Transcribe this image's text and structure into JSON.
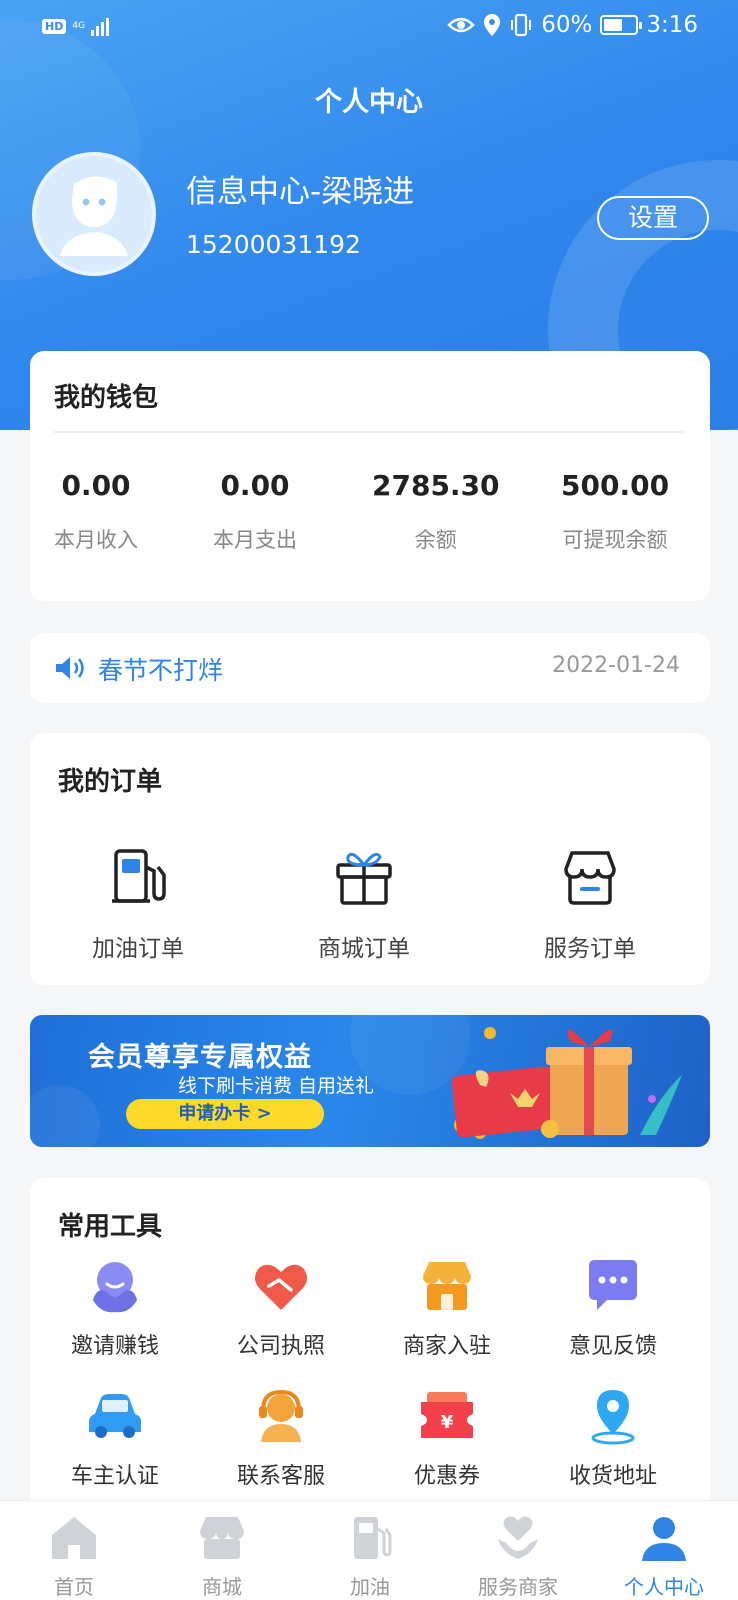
{
  "status_bar": {
    "network_badge": "HD",
    "network_type": "4G",
    "battery_percent": "60%",
    "battery_level": 0.6,
    "time": "3:16"
  },
  "page_title": "个人中心",
  "profile": {
    "name": "信息中心-梁晓进",
    "phone": "15200031192",
    "settings_label": "设置"
  },
  "wallet": {
    "title": "我的钱包",
    "stats": [
      {
        "value": "0.00",
        "label": "本月收入"
      },
      {
        "value": "0.00",
        "label": "本月支出"
      },
      {
        "value": "2785.30",
        "label": "余额"
      },
      {
        "value": "500.00",
        "label": "可提现余额"
      }
    ]
  },
  "notice": {
    "text": "春节不打烊",
    "date": "2022-01-24"
  },
  "orders": {
    "title": "我的订单",
    "items": [
      {
        "label": "加油订单",
        "icon": "fuel-pump-icon"
      },
      {
        "label": "商城订单",
        "icon": "gift-box-icon"
      },
      {
        "label": "服务订单",
        "icon": "storefront-icon"
      }
    ]
  },
  "banner": {
    "title": "会员尊享专属权益",
    "subtitle": "线下刷卡消费 自用送礼",
    "button": "申请办卡 >"
  },
  "tools": {
    "title": "常用工具",
    "items": [
      {
        "label": "邀请赚钱",
        "icon": "invite-icon"
      },
      {
        "label": "公司执照",
        "icon": "handshake-icon"
      },
      {
        "label": "商家入驻",
        "icon": "shop-icon"
      },
      {
        "label": "意见反馈",
        "icon": "feedback-icon"
      },
      {
        "label": "车主认证",
        "icon": "car-icon"
      },
      {
        "label": "联系客服",
        "icon": "customer-service-icon"
      },
      {
        "label": "优惠券",
        "icon": "coupon-icon"
      },
      {
        "label": "收货地址",
        "icon": "location-icon"
      }
    ]
  },
  "tabbar": {
    "items": [
      {
        "label": "首页",
        "icon": "home-icon",
        "active": false
      },
      {
        "label": "商城",
        "icon": "mall-icon",
        "active": false
      },
      {
        "label": "加油",
        "icon": "fuel-icon",
        "active": false
      },
      {
        "label": "服务商家",
        "icon": "service-merchant-icon",
        "active": false
      },
      {
        "label": "个人中心",
        "icon": "profile-icon",
        "active": true
      }
    ]
  },
  "colors": {
    "primary": "#2f84e6",
    "header_top": "#4aa3f3",
    "banner_button": "#ffd929",
    "inactive_tab": "#cfd3d8"
  }
}
